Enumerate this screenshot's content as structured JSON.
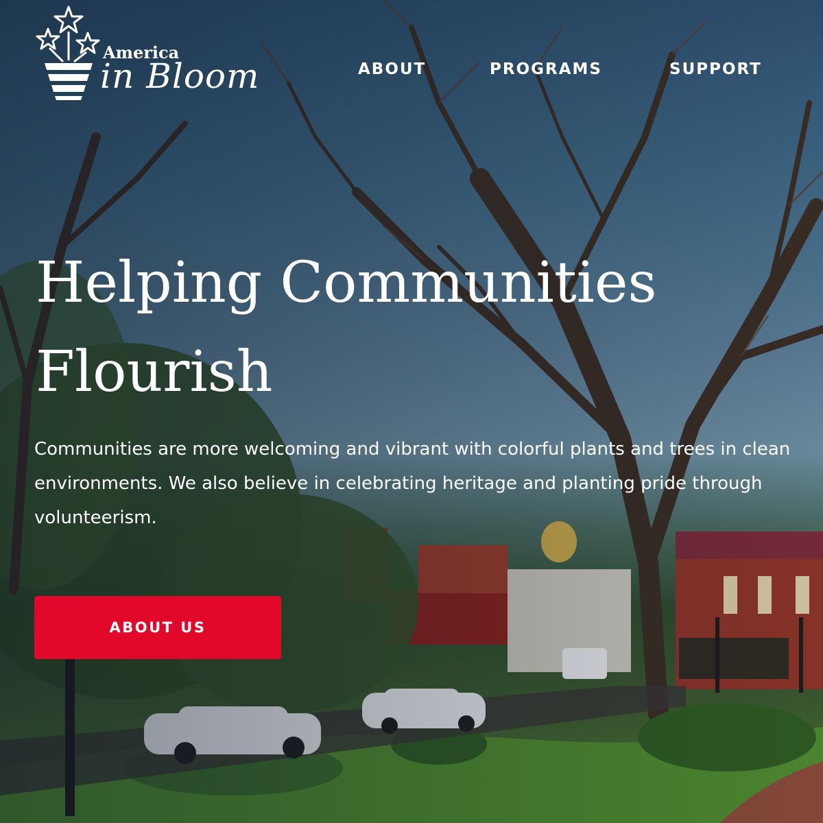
{
  "brand": {
    "line1": "America",
    "line2": "in Bloom"
  },
  "nav": {
    "about": "ABOUT",
    "programs": "PROGRAMS",
    "support": "SUPPORT"
  },
  "hero": {
    "headline_line1": "Helping Communities",
    "headline_line2": "Flourish",
    "intro_line1": "Communities are more welcoming and vibrant with colorful plants and trees in clean",
    "intro_line2": "environments. We also believe in celebrating heritage and planting pride through",
    "intro_line3": "volunteerism.",
    "cta_label": "ABOUT US"
  },
  "colors": {
    "accent": "#e2082a",
    "text": "#ffffff"
  },
  "icons": [
    "logo-star-pot-icon"
  ]
}
